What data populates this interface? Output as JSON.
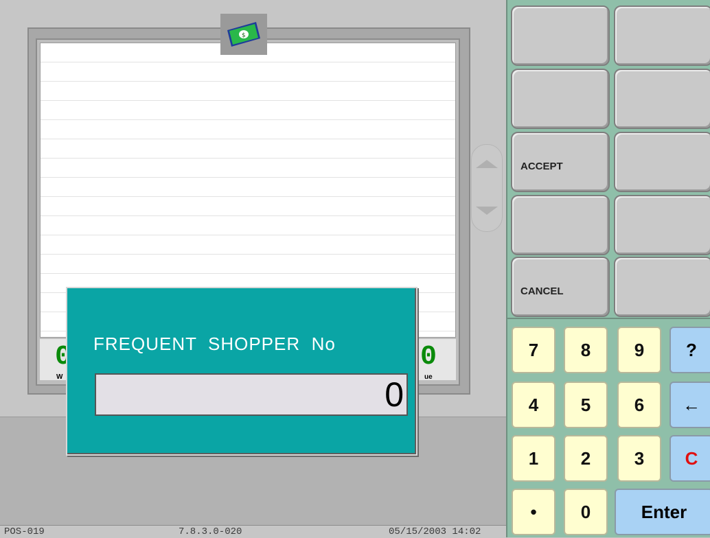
{
  "receipt": {
    "total_left_big": "0",
    "total_left_label": "W",
    "total_right_big": "0",
    "total_right_label": "ue"
  },
  "modal": {
    "title": "FREQUENT  SHOPPER  No",
    "input_value": "0",
    "background_color": "#0aa5a5"
  },
  "status_bar": {
    "terminal": "POS-019",
    "version": "7.8.3.0-020",
    "datetime": "05/15/2003 14:02"
  },
  "function_buttons": [
    {
      "label": ""
    },
    {
      "label": ""
    },
    {
      "label": ""
    },
    {
      "label": ""
    },
    {
      "label": "ACCEPT"
    },
    {
      "label": ""
    },
    {
      "label": ""
    },
    {
      "label": ""
    },
    {
      "label": "CANCEL"
    },
    {
      "label": ""
    }
  ],
  "keypad": {
    "k7": "7",
    "k8": "8",
    "k9": "9",
    "help": "?",
    "k4": "4",
    "k5": "5",
    "k6": "6",
    "back": "←",
    "k1": "1",
    "k2": "2",
    "k3": "3",
    "clear": "C",
    "dot": "•",
    "k0": "0",
    "enter": "Enter"
  },
  "icons": {
    "tender": "dollar-bill-icon"
  }
}
